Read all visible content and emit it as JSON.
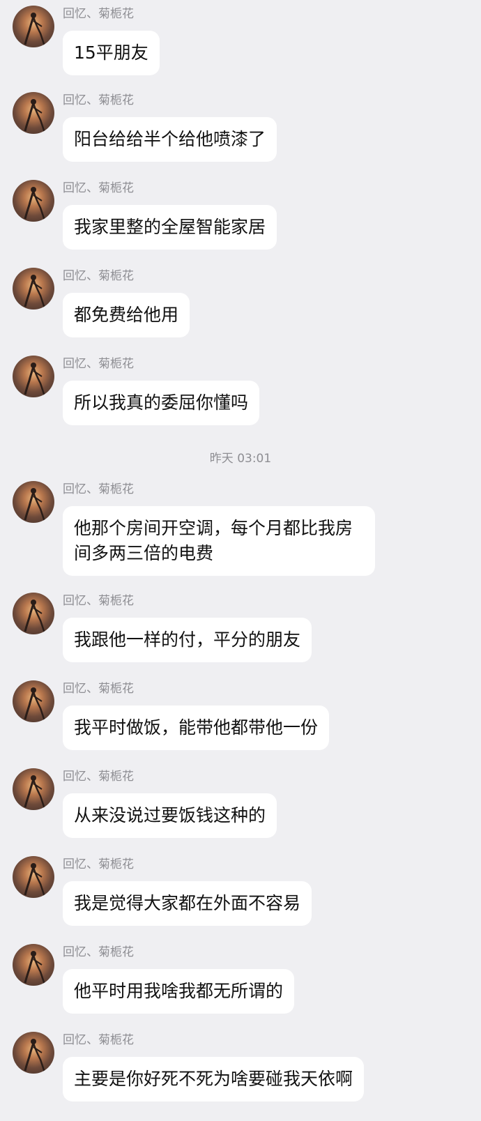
{
  "sender_name": "回忆、菊栀花",
  "timestamp": "昨天 03:01",
  "messages": [
    {
      "text": "15平朋友"
    },
    {
      "text": "阳台给给半个给他喷漆了"
    },
    {
      "text": "我家里整的全屋智能家居"
    },
    {
      "text": "都免费给他用"
    },
    {
      "text": "所以我真的委屈你懂吗"
    },
    {
      "text": "他那个房间开空调，每个月都比我房间多两三倍的电费"
    },
    {
      "text": "我跟他一样的付，平分的朋友"
    },
    {
      "text": "我平时做饭，能带他都带他一份"
    },
    {
      "text": "从来没说过要饭钱这种的"
    },
    {
      "text": "我是觉得大家都在外面不容易"
    },
    {
      "text": "他平时用我啥我都无所谓的"
    },
    {
      "text": "主要是你好死不死为啥要碰我天依啊"
    }
  ]
}
